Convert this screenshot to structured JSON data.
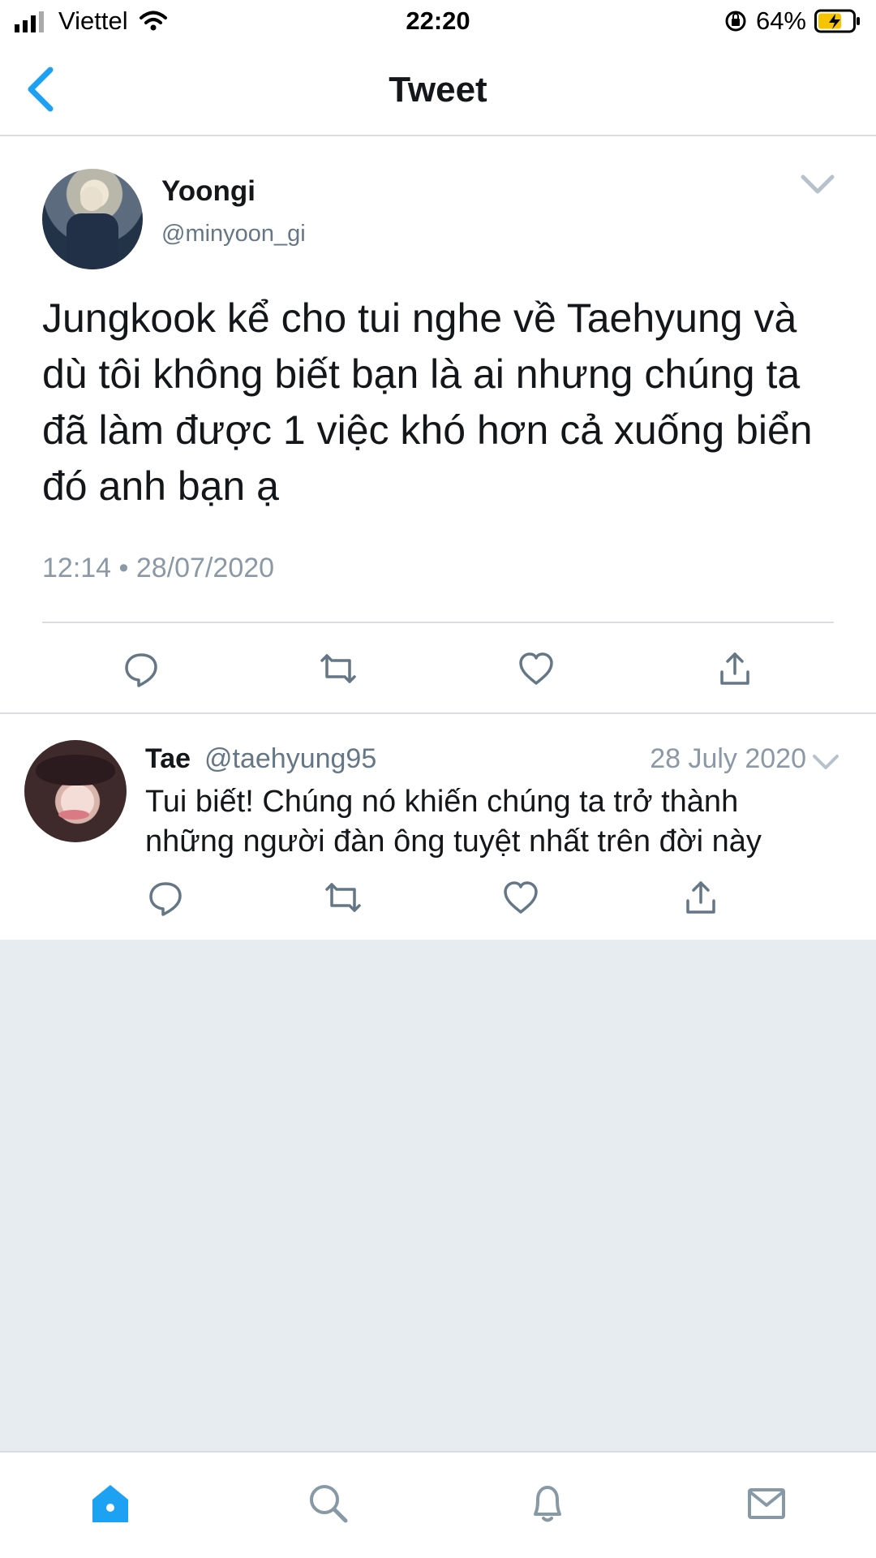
{
  "status_bar": {
    "carrier": "Viettel",
    "time": "22:20",
    "battery": "64%"
  },
  "nav": {
    "title": "Tweet"
  },
  "main_tweet": {
    "author_name": "Yoongi",
    "handle": "@minyoon_gi",
    "text": "Jungkook kể cho tui nghe về Taehyung và dù tôi không biết bạn là ai nhưng chúng ta đã làm được 1 việc khó hơn cả xuống biển đó anh bạn ạ",
    "timestamp": "12:14 • 28/07/2020"
  },
  "reply": {
    "author_name": "Tae",
    "handle": "@taehyung95",
    "date": "28 July 2020",
    "text": "Tui biết! Chúng nó khiến chúng ta trở thành những người đàn ông tuyệt nhất trên đời này"
  },
  "colors": {
    "brand": "#1da1f2",
    "text": "#14171a",
    "secondary": "#657786",
    "background_empty": "#e6ecf0",
    "divider": "#d9dde1"
  },
  "icons": [
    "signal-icon",
    "wifi-icon",
    "rotation-lock-icon",
    "battery-icon",
    "back-arrow-icon",
    "chevron-down-icon",
    "reply-icon",
    "retweet-icon",
    "like-icon",
    "share-icon",
    "home-icon",
    "search-icon",
    "notifications-icon",
    "messages-icon"
  ]
}
